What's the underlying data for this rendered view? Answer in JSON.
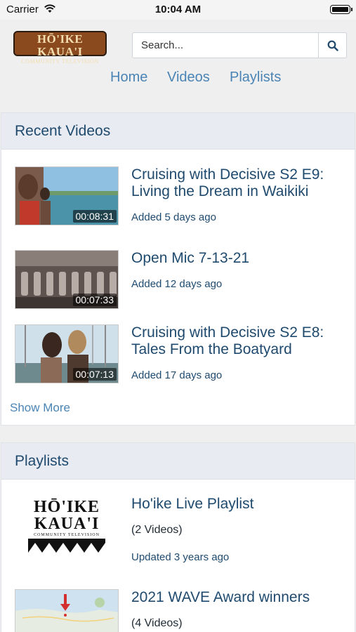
{
  "status_bar": {
    "carrier": "Carrier",
    "time": "10:04 AM"
  },
  "header": {
    "logo": {
      "main": "HŌ'IKE KAUA'I",
      "sub": "COMMUNITY TELEVISION"
    },
    "search": {
      "placeholder": "Search..."
    },
    "nav": {
      "home": "Home",
      "videos": "Videos",
      "playlists": "Playlists"
    }
  },
  "recent_videos": {
    "heading": "Recent Videos",
    "items": [
      {
        "title": "Cruising with Decisive S2 E9: Living the Dream in Waikiki",
        "duration": "00:08:31",
        "added": "Added 5 days ago"
      },
      {
        "title": "Open Mic 7-13-21",
        "duration": "00:07:33",
        "added": "Added 12 days ago"
      },
      {
        "title": "Cruising with Decisive S2 E8: Tales From the Boatyard",
        "duration": "00:07:13",
        "added": "Added 17 days ago"
      }
    ],
    "show_more": "Show More"
  },
  "playlists": {
    "heading": "Playlists",
    "items": [
      {
        "title": "Ho'ike Live Playlist",
        "count": "(2 Videos)",
        "updated": "Updated 3 years ago"
      },
      {
        "title": "2021 WAVE Award winners",
        "count": "(4 Videos)"
      }
    ]
  },
  "thumb_logo": {
    "line1": "HŌ'IKE",
    "line2": "KAUA'I",
    "line3": "COMMUNITY TELEVISION"
  },
  "colors": {
    "link": "#4a84b5",
    "text": "#1f4a6e",
    "panel_header": "#e8ebf2",
    "logo_bg": "#8b4a1e"
  }
}
